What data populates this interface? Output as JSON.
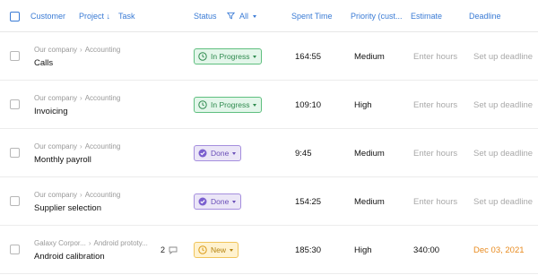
{
  "header": {
    "customer": "Customer",
    "project": "Project",
    "task": "Task",
    "status": "Status",
    "status_filter": "All",
    "spent_time": "Spent Time",
    "priority": "Priority (cust...",
    "estimate": "Estimate",
    "deadline": "Deadline"
  },
  "rows": [
    {
      "customer": "Our company",
      "project": "Accounting",
      "task": "Calls",
      "comments": "",
      "status": "In Progress",
      "spent": "164:55",
      "priority": "Medium",
      "estimate": "Enter hours",
      "deadline": "Set up deadline"
    },
    {
      "customer": "Our company",
      "project": "Accounting",
      "task": "Invoicing",
      "comments": "",
      "status": "In Progress",
      "spent": "109:10",
      "priority": "High",
      "estimate": "Enter hours",
      "deadline": "Set up deadline"
    },
    {
      "customer": "Our company",
      "project": "Accounting",
      "task": "Monthly payroll",
      "comments": "",
      "status": "Done",
      "spent": "9:45",
      "priority": "Medium",
      "estimate": "Enter hours",
      "deadline": "Set up deadline"
    },
    {
      "customer": "Our company",
      "project": "Accounting",
      "task": "Supplier selection",
      "comments": "",
      "status": "Done",
      "spent": "154:25",
      "priority": "Medium",
      "estimate": "Enter hours",
      "deadline": "Set up deadline"
    },
    {
      "customer": "Galaxy Corpor...",
      "project": "Android prototy...",
      "task": "Android calibration",
      "comments": "2",
      "status": "New",
      "spent": "185:30",
      "priority": "High",
      "estimate": "340:00",
      "deadline": "Dec 03, 2021"
    }
  ],
  "colors": {
    "accent": "#3a7bd5",
    "in_progress": "#2e8a4e",
    "done": "#6a4fb8",
    "new": "#b5830f",
    "overdue_deadline": "#e88a1e"
  },
  "icons": {
    "in_progress": "clock-icon",
    "done": "check-circle-icon",
    "new": "clock-icon",
    "comments": "comment-icon",
    "filter": "funnel-icon"
  }
}
